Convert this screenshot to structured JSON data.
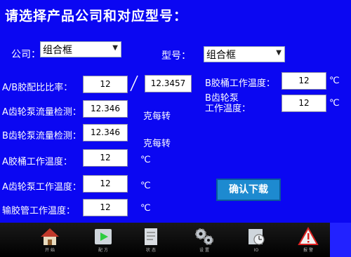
{
  "title": "请选择产品公司和对应型号：",
  "company": {
    "label": "公司：",
    "value": "组合框"
  },
  "model": {
    "label": "型号：",
    "value": "组合框"
  },
  "ab_ratio": {
    "label": "A/B胶配比比率：",
    "value_a": "12",
    "separator": "/",
    "value_b": "12.3457"
  },
  "a_flow": {
    "label": "A齿轮泵流量检测：",
    "value": "12.346",
    "unit": "克每转"
  },
  "b_flow": {
    "label": "B齿轮泵流量检测：",
    "value": "12.346",
    "unit": "克每转"
  },
  "a_barrel_temp": {
    "label": "A胶桶工作温度：",
    "value": "12",
    "unit": "℃"
  },
  "a_pump_temp": {
    "label": "A齿轮泵工作温度：",
    "value": "12",
    "unit": "℃"
  },
  "hose_temp": {
    "label": "输胶管工作温度：",
    "value": "12",
    "unit": "℃"
  },
  "b_barrel_temp": {
    "label": "B胶桶工作温度：",
    "value": "12",
    "unit": "℃"
  },
  "b_pump_temp": {
    "label_line1": "B齿轮泵",
    "label_line2": "工作温度：",
    "value": "12",
    "unit": "℃"
  },
  "confirm_button": "确认下载",
  "toolbar": [
    {
      "icon": "home-icon",
      "label": "开 始"
    },
    {
      "icon": "play-icon",
      "label": "配 方"
    },
    {
      "icon": "document-icon",
      "label": "状 态"
    },
    {
      "icon": "gears-icon",
      "label": "设 置"
    },
    {
      "icon": "clock-icon",
      "label": "IO"
    },
    {
      "icon": "alarm-icon",
      "label": "报 警"
    }
  ],
  "colors": {
    "background": "#0b07f2",
    "button": "#1d8ad0",
    "toolbar": "#000000"
  }
}
